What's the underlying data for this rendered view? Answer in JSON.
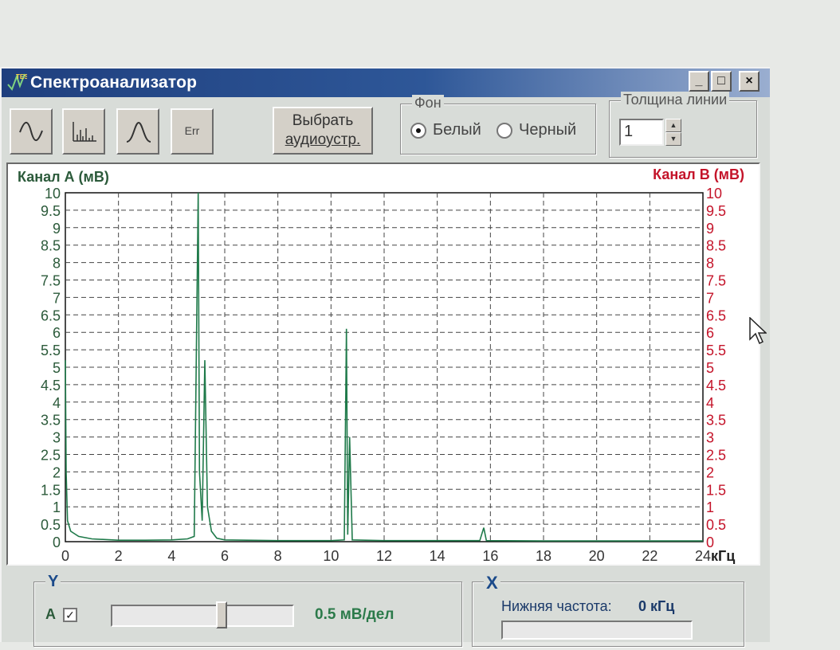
{
  "window": {
    "title": "Спектроанализатор",
    "controls": {
      "minimize": "_",
      "maximize": "□",
      "close": "×"
    }
  },
  "toolbar": {
    "buttons": [
      {
        "name": "sine-wave-icon"
      },
      {
        "name": "spectrum-bars-icon"
      },
      {
        "name": "peak-icon"
      },
      {
        "label": "Err"
      }
    ],
    "pick_device_line1": "Выбрать",
    "pick_device_line2": "аудиоустр."
  },
  "background_group": {
    "label": "Фон",
    "white": "Белый",
    "black": "Черный",
    "selected": "white"
  },
  "line_width_group": {
    "label": "Толщина линии",
    "value": "1"
  },
  "plot": {
    "channel_a_label": "Канал А (мВ)",
    "channel_b_label": "Канал В (мВ)",
    "x_unit": "кГц",
    "colors": {
      "channel_a": "#2b5a3a",
      "channel_b": "#c4142a",
      "trace": "#1f7a4a"
    }
  },
  "chart_data": {
    "type": "line",
    "xlabel": "кГц",
    "ylabel": "Канал А (мВ)",
    "y2label": "Канал В (мВ)",
    "xlim": [
      0,
      24
    ],
    "ylim": [
      0,
      10
    ],
    "x_ticks": [
      "0",
      "2",
      "4",
      "6",
      "8",
      "10",
      "12",
      "14",
      "16",
      "18",
      "20",
      "22",
      "24"
    ],
    "y_ticks": [
      "0",
      "0.5",
      "1",
      "1.5",
      "2",
      "2.5",
      "3",
      "3.5",
      "4",
      "4.5",
      "5",
      "5.5",
      "6",
      "6.5",
      "7",
      "7.5",
      "8",
      "8.5",
      "9",
      "9.5",
      "10"
    ],
    "grid": true,
    "series": [
      {
        "points": [
          [
            0.0,
            5.2
          ],
          [
            0.03,
            2.0
          ],
          [
            0.08,
            0.6
          ],
          [
            0.2,
            0.3
          ],
          [
            0.5,
            0.15
          ],
          [
            1.0,
            0.08
          ],
          [
            2.0,
            0.04
          ],
          [
            3.0,
            0.04
          ],
          [
            4.0,
            0.05
          ],
          [
            4.6,
            0.08
          ],
          [
            4.85,
            0.15
          ],
          [
            5.0,
            10.0
          ],
          [
            5.05,
            2.0
          ],
          [
            5.15,
            0.6
          ],
          [
            5.25,
            5.2
          ],
          [
            5.35,
            1.0
          ],
          [
            5.5,
            0.3
          ],
          [
            5.7,
            0.1
          ],
          [
            6.0,
            0.05
          ],
          [
            8.0,
            0.03
          ],
          [
            10.0,
            0.03
          ],
          [
            10.5,
            0.05
          ],
          [
            10.58,
            6.1
          ],
          [
            10.63,
            0.2
          ],
          [
            10.7,
            3.0
          ],
          [
            10.8,
            0.05
          ],
          [
            12.0,
            0.03
          ],
          [
            14.0,
            0.03
          ],
          [
            15.6,
            0.03
          ],
          [
            15.75,
            0.4
          ],
          [
            15.85,
            0.03
          ],
          [
            18.0,
            0.02
          ],
          [
            22.0,
            0.02
          ],
          [
            24.0,
            0.02
          ]
        ]
      }
    ]
  },
  "bottom": {
    "y_group_label": "Y",
    "channel_a_check_label": "А",
    "channel_a_checked": true,
    "scale_text": "0.5 мВ/дел",
    "x_group_label": "X",
    "lower_freq_label": "Нижняя частота:",
    "lower_freq_value": "0 кГц"
  }
}
